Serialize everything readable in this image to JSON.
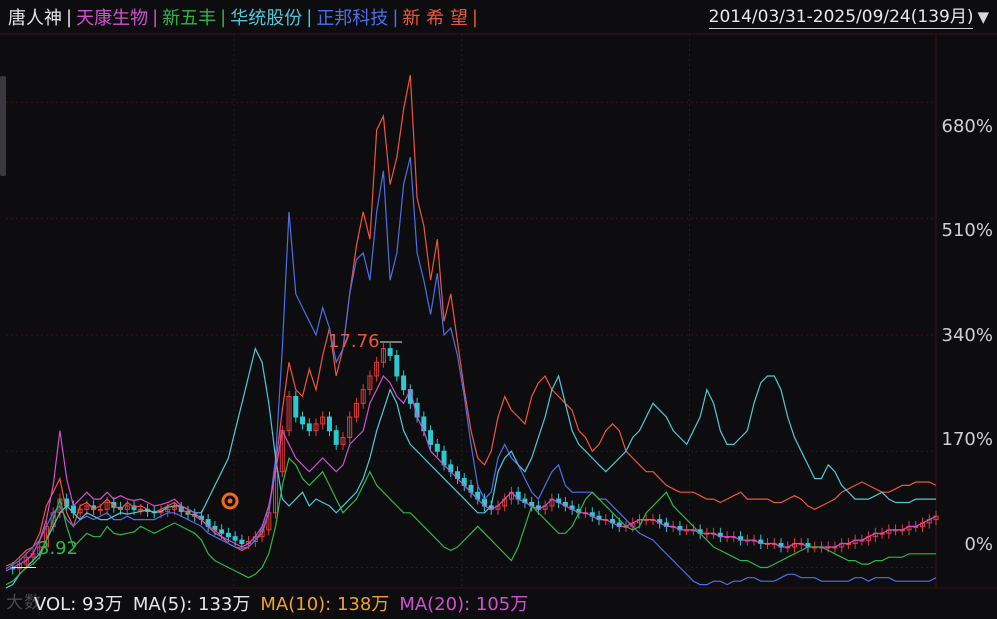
{
  "legend": [
    {
      "name": "唐人神",
      "color": "#e6e6e6"
    },
    {
      "name": "天康生物",
      "color": "#d050d0"
    },
    {
      "name": "新五丰",
      "color": "#2fb54a"
    },
    {
      "name": "华统股份",
      "color": "#4fc8d8"
    },
    {
      "name": "正邦科技",
      "color": "#4d6fe8"
    },
    {
      "name": "新 希 望",
      "color": "#f0553c"
    }
  ],
  "range_label": "2014/03/31-2025/09/24(139月)",
  "y_ticks": [
    "680%",
    "510%",
    "340%",
    "170%",
    "0%"
  ],
  "annotations": {
    "start_value": "3.92",
    "peak_label": "17.76"
  },
  "volume": {
    "vol": "VOL: 93万",
    "ma5": "MA(5): 133万",
    "ma10": "MA(10): 138万",
    "ma20": "MA(20): 105万"
  },
  "watermark": "大数",
  "colors": {
    "vol": "#e6e6e6",
    "ma5": "#e6e6e6",
    "ma10": "#f0a030",
    "ma20": "#d050d0",
    "up": "#e03c3c",
    "down": "#2ec8d2",
    "grid": "#3a1414"
  },
  "chart_data": {
    "type": "line",
    "title": "",
    "xlabel": "",
    "ylabel": "",
    "ylim": [
      -30,
      780
    ],
    "y_unit": "%",
    "x": [
      0,
      1,
      2,
      3,
      4,
      5,
      6,
      7,
      8,
      9,
      10,
      11,
      12,
      13,
      14,
      15,
      16,
      17,
      18,
      19,
      20,
      21,
      22,
      23,
      24,
      25,
      26,
      27,
      28,
      29,
      30,
      31,
      32,
      33,
      34,
      35,
      36,
      37,
      38,
      39,
      40,
      41,
      42,
      43,
      44,
      45,
      46,
      47,
      48,
      49,
      50,
      51,
      52,
      53,
      54,
      55,
      56,
      57,
      58,
      59,
      60,
      61,
      62,
      63,
      64,
      65,
      66,
      67,
      68,
      69,
      70,
      71,
      72,
      73,
      74,
      75,
      76,
      77,
      78,
      79,
      80,
      81,
      82,
      83,
      84,
      85,
      86,
      87,
      88,
      89,
      90,
      91,
      92,
      93,
      94,
      95,
      96,
      97,
      98,
      99,
      100,
      101,
      102,
      103,
      104,
      105,
      106,
      107,
      108,
      109,
      110,
      111,
      112,
      113,
      114,
      115,
      116,
      117,
      118,
      119,
      120,
      121,
      122,
      123,
      124,
      125,
      126,
      127,
      128,
      129,
      130,
      131,
      132,
      133,
      134,
      135,
      136,
      137,
      138
    ],
    "series": [
      {
        "name": "新 希 望",
        "color": "#f0553c",
        "values": [
          2,
          6,
          15,
          25,
          30,
          50,
          90,
          110,
          130,
          80,
          60,
          90,
          95,
          85,
          90,
          100,
          90,
          85,
          95,
          88,
          90,
          85,
          80,
          85,
          90,
          95,
          85,
          80,
          75,
          70,
          60,
          55,
          45,
          35,
          30,
          25,
          30,
          40,
          50,
          80,
          150,
          230,
          300,
          260,
          250,
          290,
          260,
          310,
          350,
          280,
          320,
          400,
          470,
          520,
          480,
          640,
          660,
          560,
          600,
          670,
          720,
          540,
          500,
          420,
          480,
          360,
          400,
          330,
          260,
          200,
          160,
          150,
          170,
          220,
          250,
          230,
          220,
          210,
          250,
          270,
          280,
          260,
          250,
          240,
          230,
          200,
          190,
          170,
          180,
          200,
          210,
          200,
          170,
          160,
          150,
          140,
          140,
          130,
          120,
          115,
          110,
          110,
          110,
          105,
          100,
          100,
          95,
          100,
          105,
          110,
          100,
          100,
          100,
          100,
          95,
          95,
          100,
          105,
          100,
          90,
          85,
          90,
          95,
          100,
          110,
          115,
          120,
          125,
          120,
          115,
          110,
          110,
          115,
          120,
          120,
          125,
          125,
          125,
          120
        ]
      },
      {
        "name": "正邦科技",
        "color": "#4d6fe8",
        "values": [
          -2,
          4,
          10,
          20,
          30,
          40,
          60,
          80,
          90,
          70,
          60,
          70,
          75,
          70,
          75,
          80,
          70,
          70,
          75,
          70,
          70,
          70,
          70,
          75,
          80,
          80,
          75,
          70,
          65,
          60,
          50,
          45,
          40,
          35,
          30,
          28,
          30,
          40,
          55,
          80,
          160,
          320,
          520,
          400,
          380,
          360,
          340,
          380,
          350,
          300,
          320,
          400,
          450,
          460,
          420,
          520,
          580,
          420,
          460,
          560,
          600,
          460,
          420,
          370,
          430,
          340,
          350,
          310,
          250,
          180,
          120,
          100,
          110,
          160,
          180,
          160,
          150,
          130,
          110,
          100,
          120,
          140,
          150,
          120,
          110,
          110,
          110,
          110,
          100,
          100,
          90,
          80,
          70,
          60,
          50,
          45,
          40,
          30,
          20,
          10,
          0,
          -10,
          -20,
          -25,
          -25,
          -20,
          -20,
          -25,
          -20,
          -20,
          -15,
          -15,
          -20,
          -20,
          -20,
          -15,
          -10,
          -10,
          -15,
          -15,
          -15,
          -20,
          -20,
          -20,
          -20,
          -20,
          -15,
          -15,
          -20,
          -15,
          -15,
          -15,
          -20,
          -20,
          -20,
          -20,
          -20,
          -20,
          -15
        ]
      },
      {
        "name": "华统股份",
        "color": "#4fc8d8",
        "values": [
          -30,
          -25,
          -10,
          0,
          10,
          20,
          40,
          60,
          80,
          90,
          80,
          70,
          80,
          75,
          70,
          70,
          75,
          80,
          78,
          80,
          82,
          84,
          80,
          82,
          88,
          90,
          90,
          85,
          80,
          80,
          100,
          120,
          140,
          160,
          200,
          240,
          280,
          320,
          300,
          240,
          160,
          100,
          90,
          100,
          110,
          90,
          100,
          95,
          90,
          80,
          90,
          100,
          110,
          130,
          160,
          200,
          230,
          260,
          240,
          200,
          180,
          170,
          160,
          150,
          140,
          130,
          120,
          110,
          100,
          90,
          80,
          80,
          90,
          140,
          160,
          170,
          150,
          140,
          160,
          190,
          220,
          260,
          280,
          240,
          200,
          180,
          170,
          160,
          150,
          140,
          150,
          160,
          170,
          190,
          200,
          220,
          240,
          230,
          220,
          200,
          190,
          180,
          200,
          220,
          260,
          240,
          200,
          180,
          180,
          190,
          200,
          240,
          270,
          280,
          280,
          260,
          220,
          190,
          170,
          150,
          130,
          130,
          150,
          140,
          120,
          110,
          100,
          100,
          100,
          105,
          110,
          100,
          95,
          95,
          95,
          100,
          100,
          100,
          100
        ]
      },
      {
        "name": "天康生物",
        "color": "#d050d0",
        "values": [
          -5,
          0,
          5,
          10,
          20,
          40,
          70,
          120,
          200,
          130,
          90,
          100,
          110,
          100,
          100,
          110,
          100,
          105,
          100,
          98,
          100,
          95,
          90,
          92,
          95,
          100,
          90,
          85,
          80,
          70,
          60,
          50,
          45,
          40,
          35,
          30,
          35,
          45,
          60,
          90,
          140,
          200,
          180,
          160,
          150,
          140,
          150,
          160,
          150,
          140,
          150,
          180,
          190,
          200,
          240,
          260,
          280,
          270,
          250,
          240,
          260,
          220,
          200,
          170,
          160,
          150,
          140,
          130,
          120,
          110,
          100,
          90,
          85,
          90,
          100,
          110,
          100,
          95,
          90,
          85,
          90,
          100,
          95,
          90,
          85,
          80,
          80,
          75,
          70,
          70,
          65,
          60,
          60,
          65,
          70,
          70,
          70,
          65,
          60,
          60,
          55,
          55,
          55,
          50,
          50,
          50,
          45,
          45,
          45,
          40,
          40,
          40,
          35,
          35,
          35,
          30,
          30,
          35,
          35,
          30,
          30,
          30,
          30,
          30,
          35,
          35,
          40,
          40,
          45,
          50,
          50,
          55,
          55,
          55,
          60,
          60,
          65,
          70,
          75
        ]
      },
      {
        "name": "新五丰",
        "color": "#2fb54a",
        "values": [
          -25,
          -20,
          -10,
          0,
          5,
          15,
          40,
          70,
          100,
          60,
          30,
          40,
          50,
          45,
          45,
          60,
          50,
          48,
          50,
          52,
          60,
          55,
          50,
          55,
          60,
          65,
          60,
          55,
          50,
          40,
          20,
          10,
          5,
          0,
          -5,
          -10,
          -15,
          -10,
          0,
          20,
          60,
          120,
          160,
          150,
          130,
          120,
          130,
          140,
          120,
          100,
          80,
          90,
          100,
          120,
          140,
          120,
          110,
          100,
          90,
          80,
          80,
          70,
          60,
          50,
          40,
          30,
          25,
          30,
          40,
          50,
          60,
          50,
          40,
          30,
          20,
          10,
          30,
          60,
          90,
          80,
          70,
          60,
          50,
          50,
          60,
          80,
          100,
          110,
          100,
          90,
          80,
          70,
          60,
          55,
          60,
          80,
          90,
          100,
          110,
          90,
          80,
          70,
          60,
          50,
          40,
          30,
          25,
          20,
          15,
          10,
          10,
          5,
          0,
          0,
          5,
          10,
          15,
          20,
          25,
          30,
          30,
          30,
          25,
          20,
          15,
          10,
          10,
          5,
          5,
          10,
          10,
          15,
          15,
          15,
          20,
          20,
          20,
          20,
          20
        ]
      },
      {
        "name": "唐人神",
        "color": "#e6e6e6",
        "values": [
          0,
          -2,
          5,
          15,
          20,
          30,
          60,
          80,
          100,
          90,
          80,
          85,
          90,
          85,
          85,
          95,
          88,
          85,
          90,
          85,
          85,
          82,
          80,
          82,
          85,
          88,
          82,
          78,
          75,
          70,
          60,
          55,
          50,
          45,
          40,
          35,
          38,
          45,
          55,
          80,
          140,
          200,
          250,
          220,
          210,
          200,
          210,
          220,
          200,
          180,
          190,
          220,
          240,
          260,
          280,
          300,
          320,
          310,
          280,
          260,
          240,
          220,
          200,
          180,
          170,
          150,
          140,
          130,
          120,
          110,
          100,
          90,
          85,
          90,
          100,
          110,
          100,
          95,
          90,
          85,
          90,
          100,
          95,
          90,
          85,
          80,
          80,
          75,
          70,
          70,
          65,
          60,
          60,
          65,
          70,
          70,
          70,
          65,
          60,
          60,
          55,
          55,
          55,
          50,
          50,
          50,
          45,
          45,
          45,
          40,
          40,
          40,
          35,
          35,
          35,
          30,
          30,
          35,
          35,
          30,
          30,
          30,
          30,
          30,
          35,
          35,
          40,
          40,
          45,
          50,
          50,
          55,
          55,
          55,
          60,
          60,
          65,
          70,
          75
        ]
      }
    ]
  }
}
